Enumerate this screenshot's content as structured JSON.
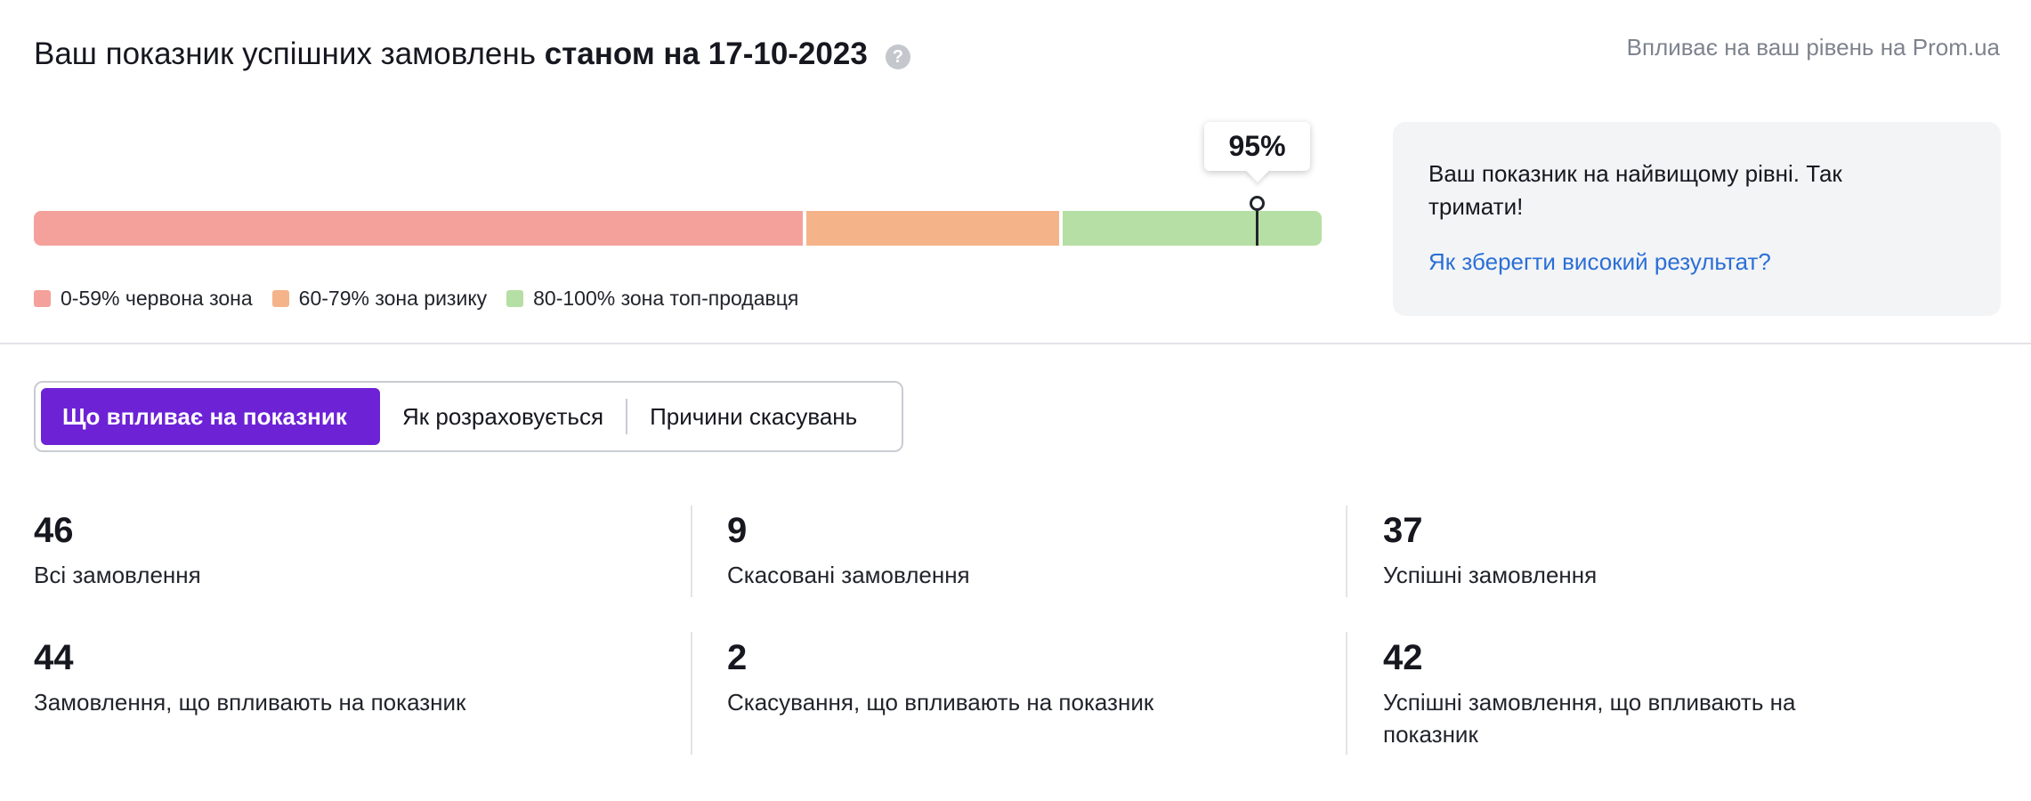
{
  "header": {
    "title_prefix": "Ваш показник успішних замовлень",
    "title_date": "станом на 17-10-2023",
    "help_glyph": "?",
    "note": "Впливає на ваш рівень на Prom.ua"
  },
  "score": {
    "label": "95%",
    "value": 95
  },
  "legend": [
    {
      "label": "0-59% червона зона",
      "color": "#f4a19b"
    },
    {
      "label": "60-79% зона ризику",
      "color": "#f5b389"
    },
    {
      "label": "80-100% зона топ-продавця",
      "color": "#b5dfa4"
    }
  ],
  "info_card": {
    "text": "Ваш показник на найвищому рівні. Так тримати!",
    "link": "Як зберегти високий результат?"
  },
  "tabs": [
    {
      "label": "Що впливає на показник",
      "active": true
    },
    {
      "label": "Як розраховується",
      "active": false
    },
    {
      "label": "Причини скасувань",
      "active": false
    }
  ],
  "stats": [
    {
      "value": "46",
      "label": "Всі замовлення"
    },
    {
      "value": "9",
      "label": "Скасовані замовлення"
    },
    {
      "value": "37",
      "label": "Успішні замовлення"
    },
    {
      "value": "44",
      "label": "Замовлення, що впливають на показник"
    },
    {
      "value": "2",
      "label": "Скасування, що впливають на показник"
    },
    {
      "value": "42",
      "label": "Успішні замовлення, що впливають на показник"
    }
  ],
  "colors": {
    "accent": "#6d22d6",
    "link": "#2b6fd6",
    "red_zone": "#f4a19b",
    "risk_zone": "#f5b389",
    "top_zone": "#b5dfa4"
  },
  "icons": {
    "help": "help-circle-icon"
  }
}
